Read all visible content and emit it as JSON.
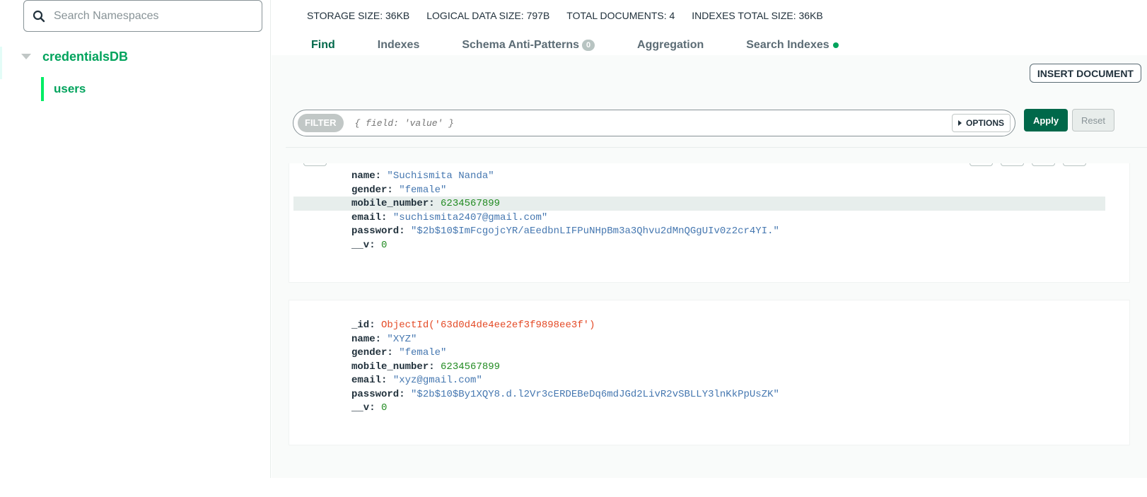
{
  "sidebar": {
    "search_placeholder": "Search Namespaces",
    "database": "credentialsDB",
    "collection": "users"
  },
  "stats": {
    "storage_label": "STORAGE SIZE:",
    "storage_value": "36KB",
    "logical_label": "LOGICAL DATA SIZE:",
    "logical_value": "797B",
    "docs_label": "TOTAL DOCUMENTS:",
    "docs_value": "4",
    "indexes_label": "INDEXES TOTAL SIZE:",
    "indexes_value": "36KB"
  },
  "tabs": {
    "find": "Find",
    "indexes": "Indexes",
    "schema": "Schema Anti-Patterns",
    "schema_count": "0",
    "aggregation": "Aggregation",
    "search_indexes": "Search Indexes"
  },
  "toolbar": {
    "insert_label": "INSERT DOCUMENT",
    "filter_label": "FILTER",
    "filter_placeholder": "{ field: 'value' }",
    "options_label": "OPTIONS",
    "apply_label": "Apply",
    "reset_label": "Reset"
  },
  "documents": [
    {
      "name_key": "name:",
      "name_val": "\"Suchismita Nanda\"",
      "gender_key": "gender:",
      "gender_val": "\"female\"",
      "mobile_key": "mobile_number:",
      "mobile_val": "6234567899",
      "email_key": "email:",
      "email_val": "\"suchismita2407@gmail.com\"",
      "password_key": "password:",
      "password_val": "\"$2b$10$ImFcgojcYR/aEedbnLIFPuNHpBm3a3Qhvu2dMnQGgUIv0z2cr4YI.\"",
      "v_key": "__v:",
      "v_val": "0"
    },
    {
      "id_key": "_id:",
      "id_val": "ObjectId('63d0d4de4ee2ef3f9898ee3f')",
      "name_key": "name:",
      "name_val": "\"XYZ\"",
      "gender_key": "gender:",
      "gender_val": "\"female\"",
      "mobile_key": "mobile_number:",
      "mobile_val": "6234567899",
      "email_key": "email:",
      "email_val": "\"xyz@gmail.com\"",
      "password_key": "password:",
      "password_val": "\"$2b$10$By1XQY8.d.l2Vr3cERDEBeDq6mdJGd2LivR2vSBLLY3lnKkPpUsZK\"",
      "v_key": "__v:",
      "v_val": "0"
    }
  ],
  "colors": {
    "accent": "#00684a",
    "nav_green": "#00a35c",
    "string": "#4577b0",
    "number": "#228b22",
    "objectid": "#e44b27"
  },
  "icons": [
    "search-icon",
    "chevron-down-icon",
    "caret-right-icon",
    "status-dot-icon"
  ]
}
